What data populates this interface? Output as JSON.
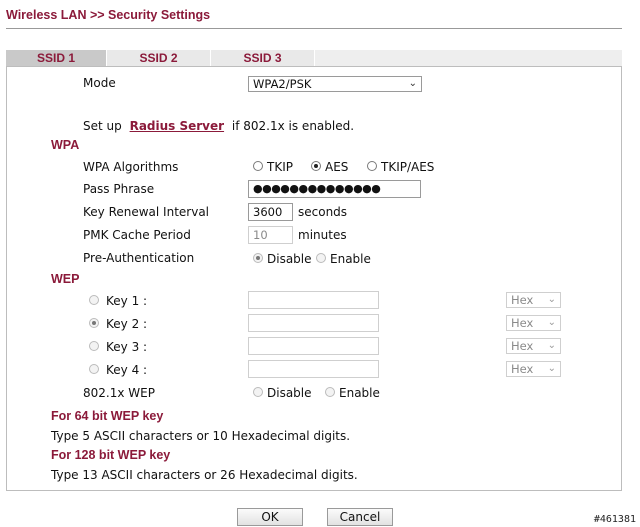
{
  "page_title": "Wireless LAN >> Security Settings",
  "tabs": [
    {
      "label": "SSID 1",
      "active": true
    },
    {
      "label": "SSID 2",
      "active": false
    },
    {
      "label": "SSID 3",
      "active": false
    }
  ],
  "mode": {
    "label": "Mode",
    "value": "WPA2/PSK"
  },
  "setup": {
    "prefix": "Set up",
    "link": "Radius Server",
    "suffix": "if 802.1x is enabled."
  },
  "wpa": {
    "section": "WPA",
    "algorithms": {
      "label": "WPA Algorithms",
      "options": [
        "TKIP",
        "AES",
        "TKIP/AES"
      ],
      "selected": "AES"
    },
    "pass_phrase": {
      "label": "Pass Phrase",
      "value": "●●●●●●●●●●●●●●"
    },
    "key_renewal": {
      "label": "Key Renewal Interval",
      "value": "3600",
      "unit": "seconds"
    },
    "pmk_cache": {
      "label": "PMK Cache Period",
      "value": "10",
      "unit": "minutes"
    },
    "pre_auth": {
      "label": "Pre-Authentication",
      "options": [
        "Disable",
        "Enable"
      ],
      "selected": "Disable"
    }
  },
  "wep": {
    "section": "WEP",
    "keys": [
      {
        "label": "Key 1 :",
        "selected": false,
        "format": "Hex"
      },
      {
        "label": "Key 2 :",
        "selected": true,
        "format": "Hex"
      },
      {
        "label": "Key 3 :",
        "selected": false,
        "format": "Hex"
      },
      {
        "label": "Key 4 :",
        "selected": false,
        "format": "Hex"
      }
    ],
    "x8021": {
      "label": "802.1x WEP",
      "options": [
        "Disable",
        "Enable"
      ],
      "selected": "none"
    }
  },
  "notes": {
    "h64": "For 64 bit WEP key",
    "t64": "Type 5 ASCII characters or 10 Hexadecimal digits.",
    "h128": "For 128 bit WEP key",
    "t128": "Type 13 ASCII characters or 26 Hexadecimal digits."
  },
  "buttons": {
    "ok": "OK",
    "cancel": "Cancel"
  },
  "watermark": "#461381",
  "icons": {
    "dropdown": "chevron-down-icon"
  }
}
